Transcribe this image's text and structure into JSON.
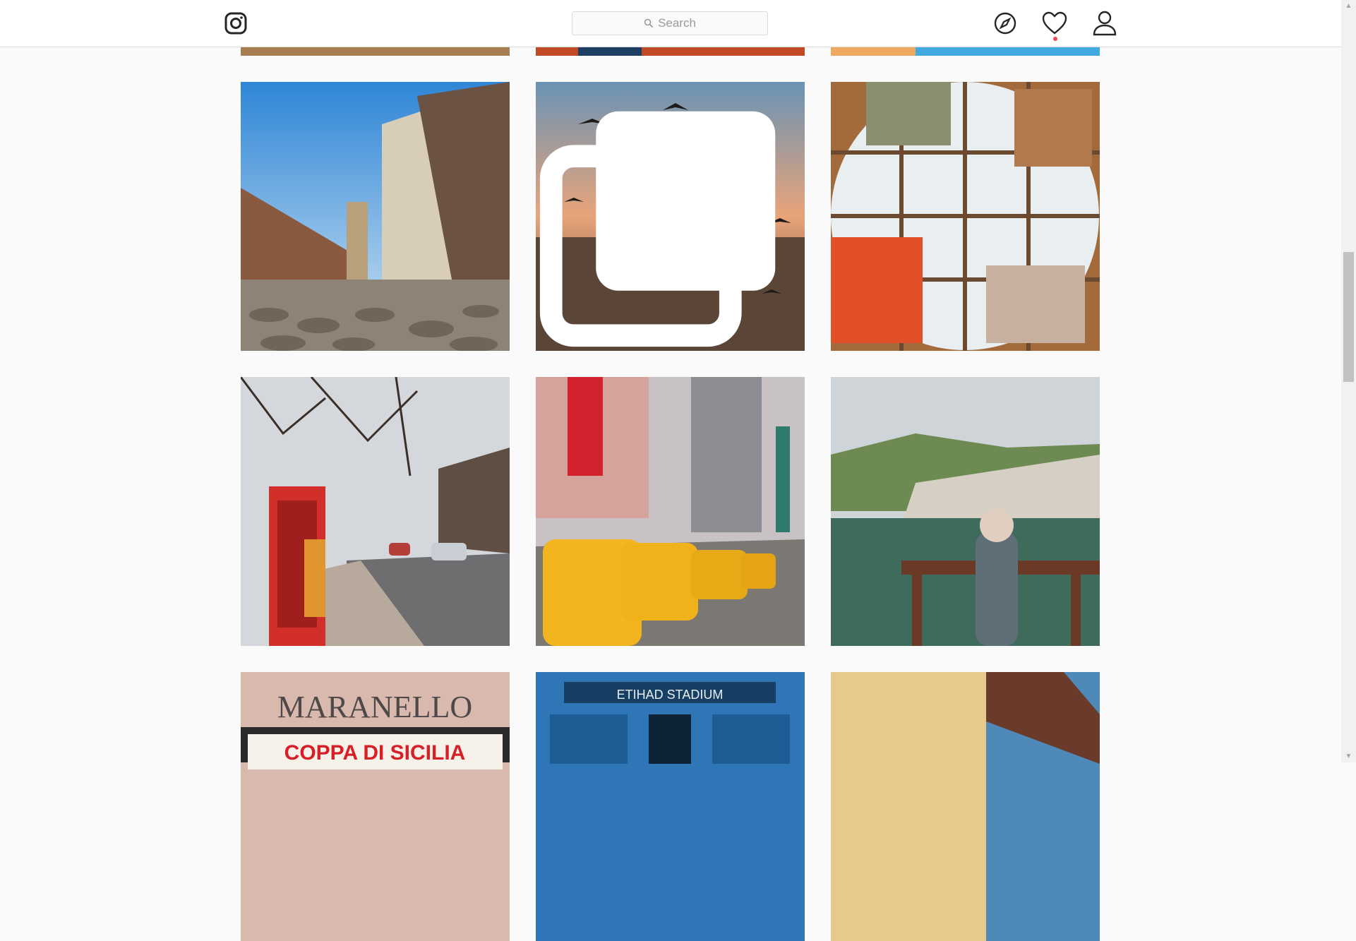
{
  "header": {
    "logo_icon": "instagram-icon",
    "search_placeholder": "Search",
    "search_icon": "search-icon",
    "nav_icons": [
      "compass-icon",
      "heart-icon",
      "user-icon"
    ],
    "notification_color": "#ed4956"
  },
  "grid": {
    "posts": [
      {
        "row": 0,
        "col": 1,
        "subject": "partially visible photo"
      },
      {
        "row": 0,
        "col": 2,
        "subject": "partially visible photo"
      },
      {
        "row": 0,
        "col": 3,
        "subject": "partially visible photo"
      },
      {
        "row": 1,
        "col": 1,
        "subject": "cobblestone street with old houses"
      },
      {
        "row": 1,
        "col": 2,
        "subject": "seagulls over water at sunset",
        "multi_image": true
      },
      {
        "row": 1,
        "col": 3,
        "subject": "people under dome ceiling"
      },
      {
        "row": 2,
        "col": 1,
        "subject": "woman next to red phone booth"
      },
      {
        "row": 2,
        "col": 2,
        "subject": "yellow taxis in city street"
      },
      {
        "row": 2,
        "col": 3,
        "subject": "woman overlooking lake and hills"
      },
      {
        "row": 3,
        "col": 1,
        "subject": "theater marquee",
        "text": [
          "MARANELLO",
          "COPPA DI SICILIA"
        ]
      },
      {
        "row": 3,
        "col": 2,
        "subject": "stadium entrance",
        "text": [
          "ETIHAD STADIUM"
        ]
      },
      {
        "row": 3,
        "col": 3,
        "subject": "building roof corner against sky"
      }
    ]
  },
  "scrollbar": {
    "icons": [
      "scroll-up-arrow",
      "scroll-down-arrow"
    ]
  }
}
